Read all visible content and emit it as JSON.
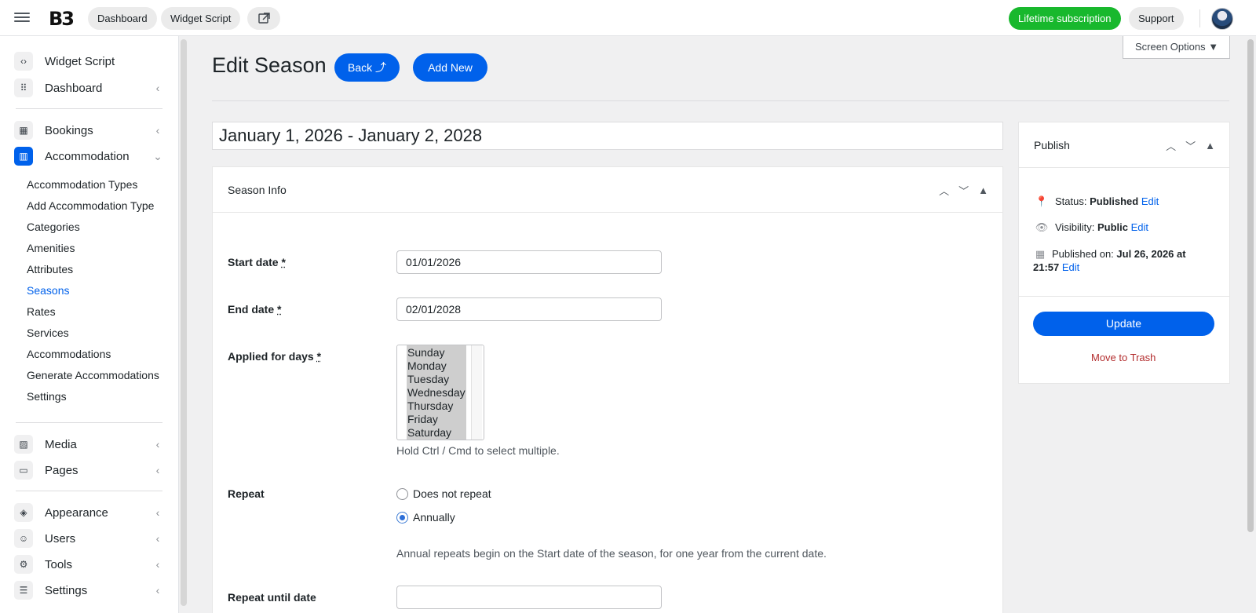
{
  "topbar": {
    "logo": "B3",
    "dashboard_label": "Dashboard",
    "widget_script_label": "Widget Script",
    "external_link_icon": "external-link-icon",
    "lifetime_label": "Lifetime subscription",
    "support_label": "Support",
    "accent_green": "#18b82d"
  },
  "sidebar": {
    "top_items": [
      {
        "label": "Widget Script",
        "icon": "code-icon"
      },
      {
        "label": "Dashboard",
        "icon": "grid-icon"
      }
    ],
    "bookings_label": "Bookings",
    "accommodation_label": "Accommodation",
    "sub_items": [
      "Accommodation Types",
      "Add Accommodation Type",
      "Categories",
      "Amenities",
      "Attributes",
      "Seasons",
      "Rates",
      "Services",
      "Accommodations",
      "Generate Accommodations",
      "Settings"
    ],
    "current_sub": "Seasons",
    "media_label": "Media",
    "pages_label": "Pages",
    "appearance_label": "Appearance",
    "users_label": "Users",
    "tools_label": "Tools",
    "settings_label": "Settings"
  },
  "header": {
    "screen_options": "Screen Options ▼",
    "title": "Edit Season",
    "back_label": "Back ⤴",
    "add_new_label": "Add New",
    "season_title": "January 1, 2026 - January 2, 2028",
    "accent_blue": "#0061eb"
  },
  "season_info": {
    "heading": "Season Info",
    "start_label": "Start date",
    "start_value": "01/01/2026",
    "end_label": "End date",
    "end_value": "02/01/2028",
    "days_label": "Applied for days",
    "required_mark": "*",
    "days": [
      "Sunday",
      "Monday",
      "Tuesday",
      "Wednesday",
      "Thursday",
      "Friday",
      "Saturday"
    ],
    "days_help": "Hold Ctrl / Cmd to select multiple.",
    "repeat_label": "Repeat",
    "repeat_options": [
      "Does not repeat",
      "Annually"
    ],
    "repeat_selected": "Annually",
    "repeat_help": "Annual repeats begin on the Start date of the season, for one year from the current date.",
    "repeat_until_label": "Repeat until date",
    "repeat_until_value": ""
  },
  "publish": {
    "heading": "Publish",
    "status_prefix": "Status: ",
    "status_value": "Published",
    "visibility_prefix": "Visibility: ",
    "visibility_value": "Public",
    "published_prefix": "Published on: ",
    "published_value_line1": "Jul 26, 2026 at",
    "published_value_line2": "21:57",
    "edit_label": "Edit",
    "update_label": "Update",
    "trash_label": "Move to Trash"
  }
}
